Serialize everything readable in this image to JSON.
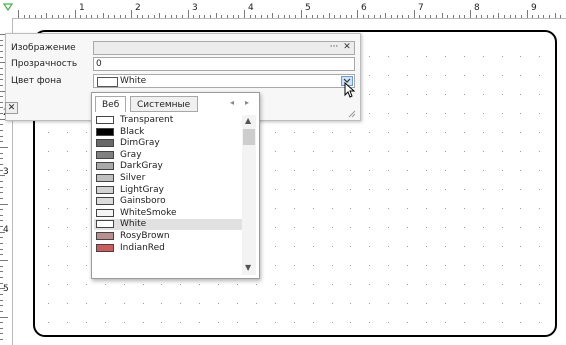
{
  "ruler": {
    "top_numbers": [
      "1",
      "2",
      "3",
      "4",
      "5",
      "6",
      "7",
      "8",
      "9"
    ],
    "left_numbers": [
      "2",
      "3",
      "4",
      "5"
    ]
  },
  "properties": {
    "image_label": "Изображение",
    "image_value": "",
    "image_browse": "···",
    "image_clear": "✕",
    "opacity_label": "Прозрачность",
    "opacity_value": "0",
    "bgcolor_label": "Цвет фона",
    "bgcolor_value": "White",
    "close_symbol": "✕"
  },
  "dropdown": {
    "tabs": [
      "Веб",
      "Системные"
    ],
    "active_tab": "Веб",
    "nav_left": "◂",
    "nav_right": "▸",
    "selected": "White",
    "colors": [
      {
        "name": "Transparent",
        "color": "#ffffff"
      },
      {
        "name": "Black",
        "color": "#000000"
      },
      {
        "name": "DimGray",
        "color": "#696969"
      },
      {
        "name": "Gray",
        "color": "#808080"
      },
      {
        "name": "DarkGray",
        "color": "#a9a9a9"
      },
      {
        "name": "Silver",
        "color": "#c0c0c0"
      },
      {
        "name": "LightGray",
        "color": "#d3d3d3"
      },
      {
        "name": "Gainsboro",
        "color": "#dcdcdc"
      },
      {
        "name": "WhiteSmoke",
        "color": "#f5f5f5"
      },
      {
        "name": "White",
        "color": "#ffffff"
      },
      {
        "name": "RosyBrown",
        "color": "#bc8f8f"
      },
      {
        "name": "IndianRed",
        "color": "#cd5c5c"
      }
    ]
  }
}
